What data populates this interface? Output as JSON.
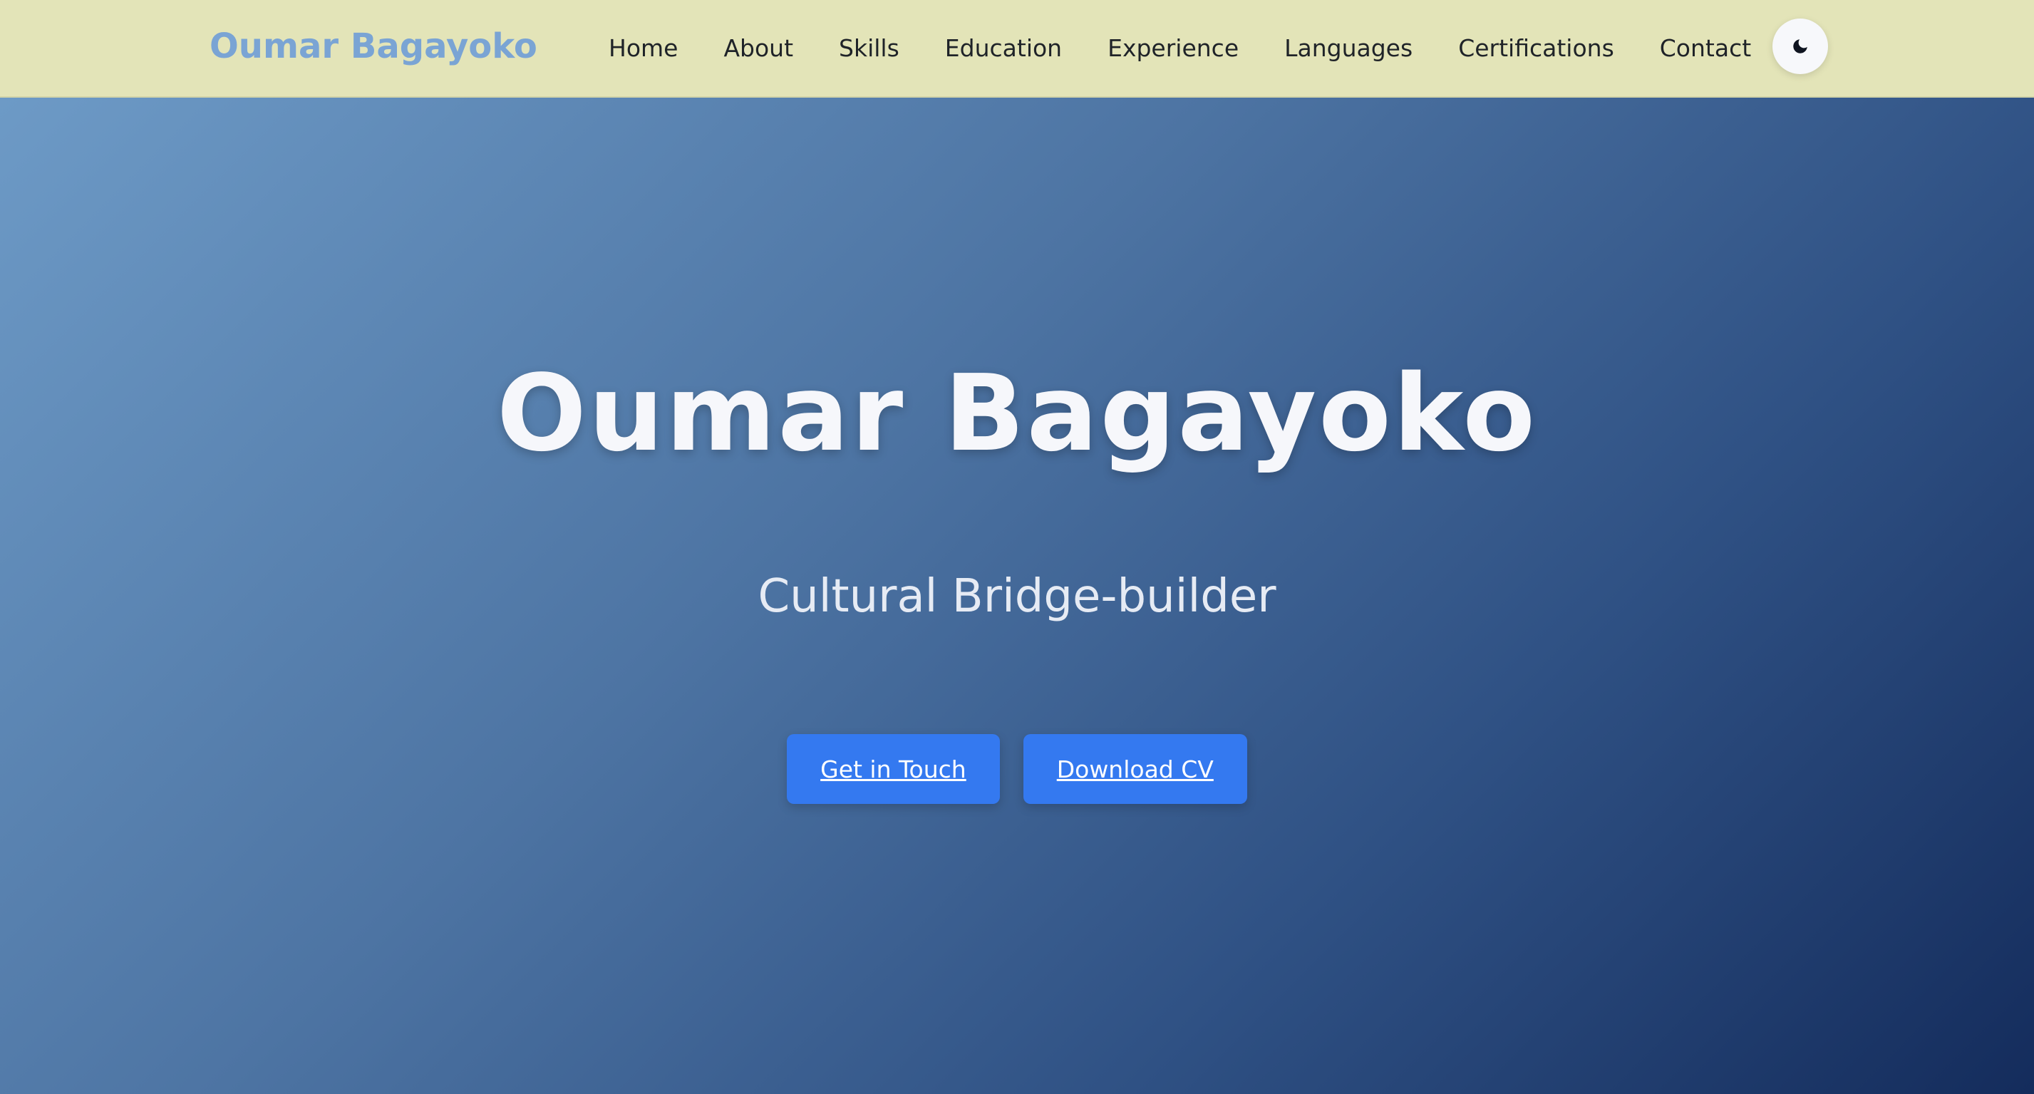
{
  "nav": {
    "brand": "Oumar Bagayoko",
    "links": [
      {
        "label": "Home"
      },
      {
        "label": "About"
      },
      {
        "label": "Skills"
      },
      {
        "label": "Education"
      },
      {
        "label": "Experience"
      },
      {
        "label": "Languages"
      },
      {
        "label": "Certifications"
      },
      {
        "label": "Contact"
      }
    ],
    "theme_toggle_icon": "moon-icon"
  },
  "hero": {
    "title": "Oumar Bagayoko",
    "subtitle": "Cultural Bridge-builder",
    "primary_button": "Get in Touch",
    "secondary_button": "Download CV"
  },
  "colors": {
    "navbar_background": "#e3e4b8",
    "brand": "#7aa4d4",
    "button": "#3479f0",
    "hero_gradient_start": "#6d9ac6",
    "hero_gradient_end": "#142c5c"
  }
}
